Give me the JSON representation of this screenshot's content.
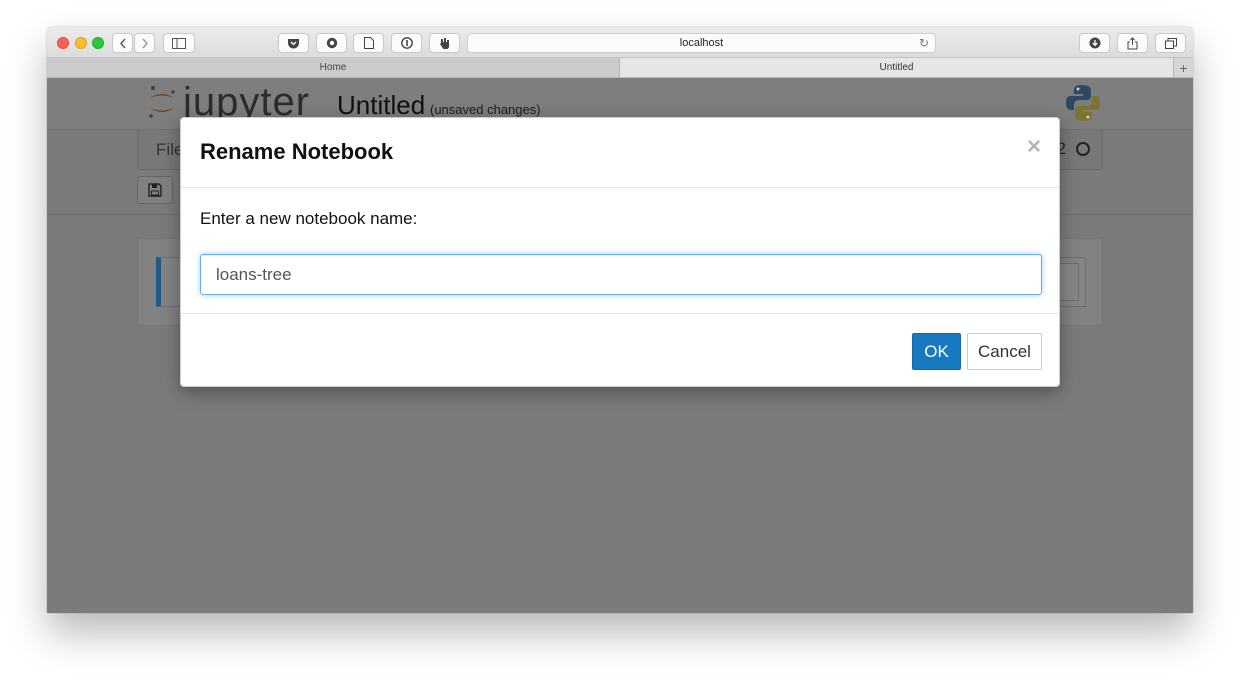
{
  "browser": {
    "url": "localhost",
    "tabs": [
      {
        "label": "Home",
        "active": false
      },
      {
        "label": "Untitled",
        "active": true
      }
    ],
    "new_tab_label": "+"
  },
  "notebook": {
    "logo_text": "jupyter",
    "title": "Untitled",
    "status": "(unsaved changes)",
    "menu_first": "File",
    "kernel_text": "2"
  },
  "modal": {
    "title": "Rename Notebook",
    "close_glyph": "×",
    "prompt": "Enter a new notebook name:",
    "input_value": "loans-tree",
    "ok_label": "OK",
    "cancel_label": "Cancel"
  },
  "colors": {
    "primary": "#1779c0",
    "focus": "#66afe9",
    "jupyter_orange": "#f37726"
  }
}
